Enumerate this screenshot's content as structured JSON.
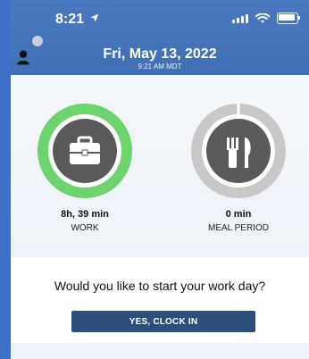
{
  "status_bar": {
    "time": "8:21",
    "icons": [
      "location-arrow-icon",
      "signal-icon",
      "wifi-icon",
      "battery-icon"
    ]
  },
  "header": {
    "date": "Fri, May 13, 2022",
    "subtime": "9:21 AM MDT",
    "icons": [
      "user-icon"
    ]
  },
  "stats": {
    "work": {
      "value": "8h, 39 min",
      "label": "WORK",
      "ring_color": "#6dd36d",
      "progress": 1.0,
      "icon": "briefcase-icon"
    },
    "meal": {
      "value": "0 min",
      "label": "MEAL PERIOD",
      "ring_color": "#c8c8c8",
      "progress": 0.0,
      "icon": "fork-knife-icon"
    }
  },
  "prompt": {
    "question": "Would you like to start your work day?",
    "button_label": "YES, CLOCK IN",
    "button_color": "#2b4f7b"
  },
  "colors": {
    "header": "#4a79bf",
    "accent": "#6dd36d",
    "background": "#3f6fc6"
  }
}
